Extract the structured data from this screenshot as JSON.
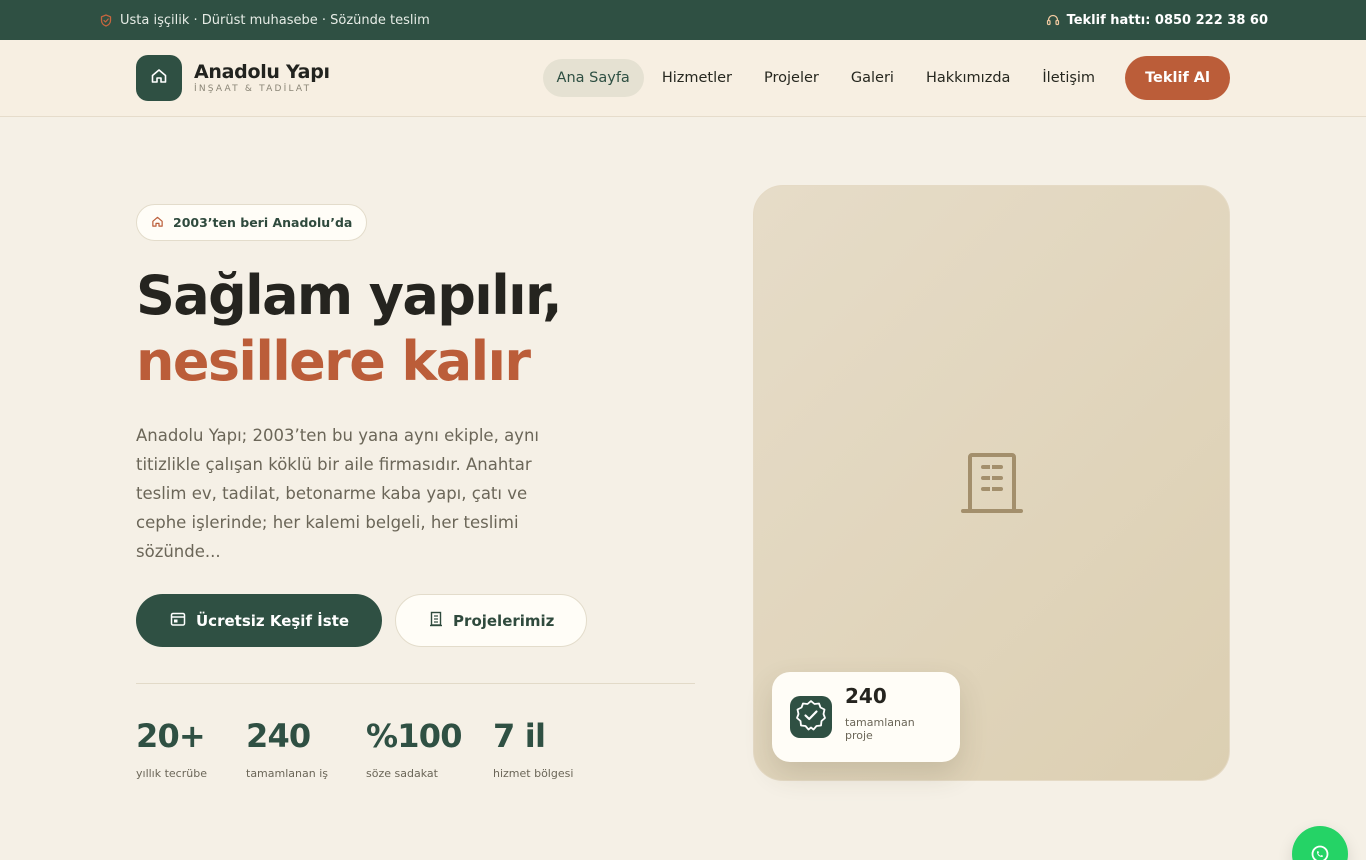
{
  "topbar": {
    "tagline": "Usta işçilik · Dürüst muhasebe · Sözünde teslim",
    "hotline": "Teklif hattı: 0850 222 38 60"
  },
  "header": {
    "brand_name": "Anadolu Yapı",
    "brand_sub": "İNŞAAT & TADİLAT",
    "nav": [
      {
        "label": "Ana Sayfa",
        "active": true
      },
      {
        "label": "Hizmetler"
      },
      {
        "label": "Projeler"
      },
      {
        "label": "Galeri"
      },
      {
        "label": "Hakkımızda"
      },
      {
        "label": "İletişim"
      }
    ],
    "cta": "Teklif Al"
  },
  "hero": {
    "badge": "2003’ten beri Anadolu’da",
    "headline_1": "Sağlam yapılır,",
    "headline_2": "nesillere kalır",
    "description": "Anadolu Yapı; 2003’ten bu yana aynı ekiple, aynı titizlikle çalışan köklü bir aile firmasıdır. Anahtar teslim ev, tadilat, betonarme kaba yapı, çatı ve cephe işlerinde; her kalemi belgeli, her teslimi sözünde...",
    "primary_button": "Ücretsiz Keşif İste",
    "secondary_button": "Projelerimiz",
    "stats": [
      {
        "value": "20+",
        "label": "yıllık tecrübe"
      },
      {
        "value": "240",
        "label": "tamamlanan iş"
      },
      {
        "value": "%100",
        "label": "söze sadakat"
      },
      {
        "value": "7 il",
        "label": "hizmet bölgesi"
      }
    ]
  },
  "float_card": {
    "value": "240",
    "label": "tamamlanan proje"
  },
  "colors": {
    "primary": "#2f5043",
    "accent": "#bb5d39",
    "background": "#f5f0e6",
    "whatsapp": "#25d366"
  },
  "icons": {
    "topbar_left": "shield-icon",
    "topbar_right": "headset-icon",
    "brand": "home-icon",
    "badge": "home-icon",
    "primary_button": "calendar-icon",
    "secondary_button": "building-icon",
    "image_placeholder": "building-icon",
    "float_card": "verified-badge-icon",
    "floating_action": "whatsapp-icon"
  }
}
